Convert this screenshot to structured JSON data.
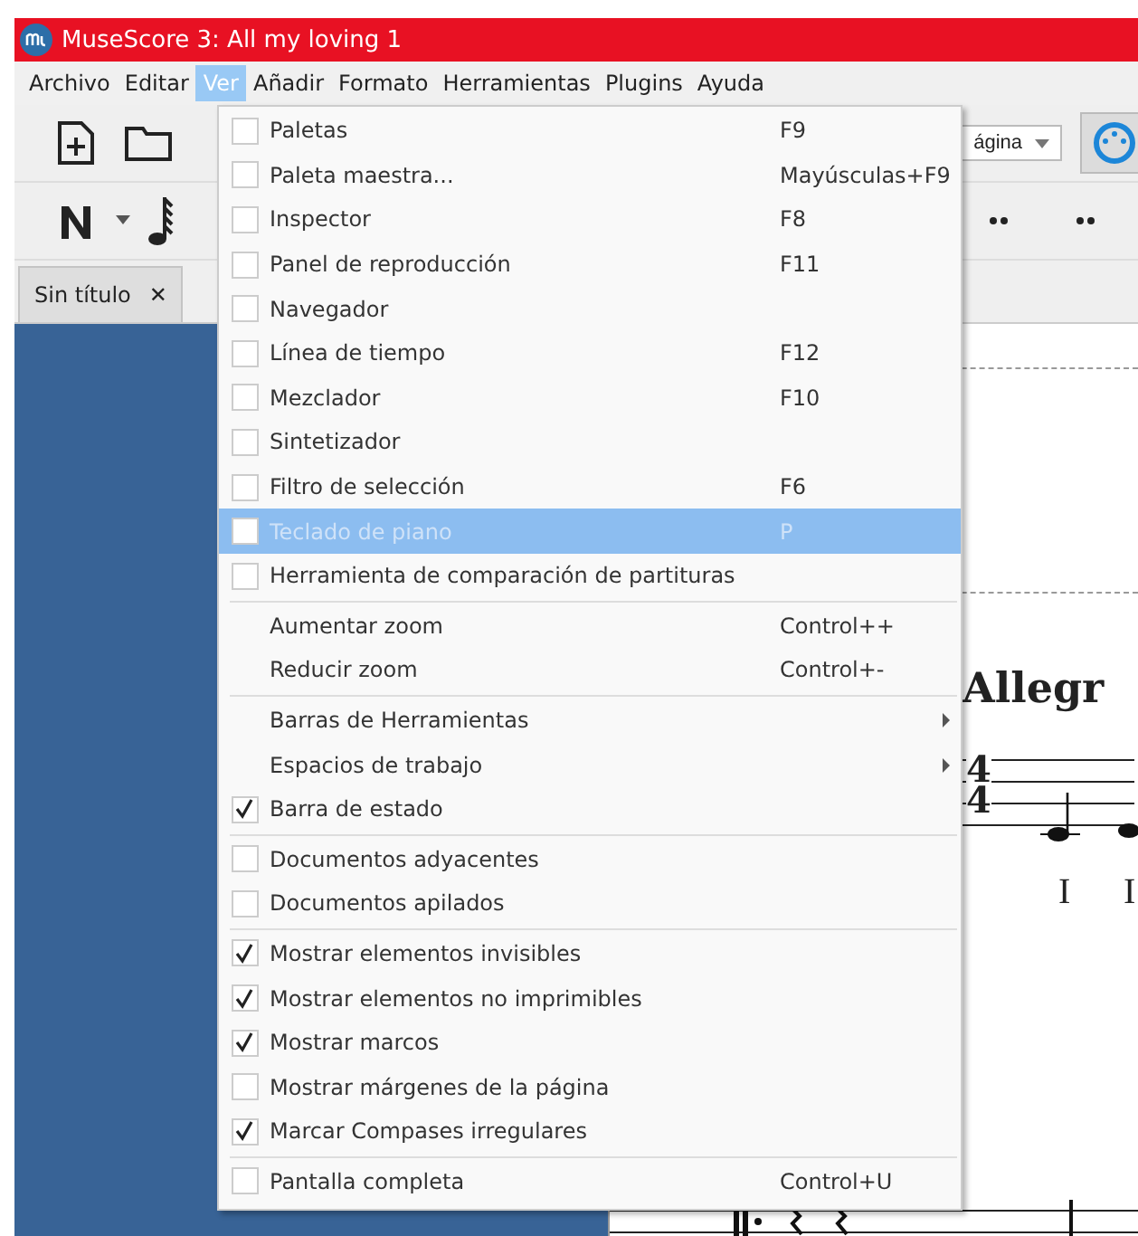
{
  "window": {
    "title": "MuseScore 3: All my loving 1"
  },
  "menu_bar": [
    {
      "label": "Archivo",
      "selected": false
    },
    {
      "label": "Editar",
      "selected": false
    },
    {
      "label": "Ver",
      "selected": true
    },
    {
      "label": "Añadir",
      "selected": false
    },
    {
      "label": "Formato",
      "selected": false
    },
    {
      "label": "Herramientas",
      "selected": false
    },
    {
      "label": "Plugins",
      "selected": false
    },
    {
      "label": "Ayuda",
      "selected": false
    }
  ],
  "toolbar": {
    "view_dropdown": "ágina"
  },
  "tabs": [
    {
      "label": "Sin título",
      "close": "✕"
    }
  ],
  "view_menu": [
    [
      {
        "kind": "check",
        "label": "Paletas",
        "shortcut": "F9",
        "checked": false,
        "selected": false,
        "disabled": false
      },
      {
        "kind": "check",
        "label": "Paleta maestra...",
        "shortcut": "Mayúsculas+F9",
        "checked": false,
        "selected": false,
        "disabled": false
      },
      {
        "kind": "check",
        "label": "Inspector",
        "shortcut": "F8",
        "checked": false,
        "selected": false,
        "disabled": false
      },
      {
        "kind": "check",
        "label": "Panel de reproducción",
        "shortcut": "F11",
        "checked": false,
        "selected": false,
        "disabled": false
      },
      {
        "kind": "check",
        "label": "Navegador",
        "checked": false,
        "selected": false,
        "disabled": false
      },
      {
        "kind": "check",
        "label": "Línea de tiempo",
        "shortcut": "F12",
        "checked": false,
        "selected": false,
        "disabled": false
      },
      {
        "kind": "check",
        "label": "Mezclador",
        "shortcut": "F10",
        "checked": false,
        "selected": false,
        "disabled": false
      },
      {
        "kind": "check",
        "label": "Sintetizador",
        "checked": false,
        "selected": false,
        "disabled": false
      },
      {
        "kind": "check",
        "label": "Filtro de selección",
        "shortcut": "F6",
        "checked": false,
        "selected": false,
        "disabled": false
      },
      {
        "kind": "check",
        "label": "Teclado de piano",
        "shortcut": "P",
        "checked": false,
        "selected": true,
        "disabled": true
      },
      {
        "kind": "check",
        "label": "Herramienta de comparación de partituras",
        "checked": false,
        "selected": false,
        "disabled": false
      }
    ],
    [
      {
        "kind": "plain",
        "label": "Aumentar zoom",
        "shortcut": "Control++",
        "selected": false,
        "disabled": false
      },
      {
        "kind": "plain",
        "label": "Reducir zoom",
        "shortcut": "Control+-",
        "selected": false,
        "disabled": false
      }
    ],
    [
      {
        "kind": "submenu",
        "label": "Barras de Herramientas",
        "selected": false,
        "disabled": false
      },
      {
        "kind": "submenu",
        "label": "Espacios de trabajo",
        "selected": false,
        "disabled": false
      },
      {
        "kind": "check",
        "label": "Barra de estado",
        "checked": true,
        "selected": false,
        "disabled": false
      }
    ],
    [
      {
        "kind": "check",
        "label": "Documentos adyacentes",
        "checked": false,
        "selected": false,
        "disabled": false
      },
      {
        "kind": "check",
        "label": "Documentos apilados",
        "checked": false,
        "selected": false,
        "disabled": false
      }
    ],
    [
      {
        "kind": "check",
        "label": "Mostrar elementos invisibles",
        "checked": true,
        "selected": false,
        "disabled": false
      },
      {
        "kind": "check",
        "label": "Mostrar elementos no imprimibles",
        "checked": true,
        "selected": false,
        "disabled": false
      },
      {
        "kind": "check",
        "label": "Mostrar marcos",
        "checked": true,
        "selected": false,
        "disabled": false
      },
      {
        "kind": "check",
        "label": "Mostrar márgenes de la página",
        "checked": false,
        "selected": false,
        "disabled": false
      },
      {
        "kind": "check",
        "label": "Marcar Compases irregulares",
        "checked": true,
        "selected": false,
        "disabled": false
      }
    ],
    [
      {
        "kind": "check",
        "label": "Pantalla completa",
        "shortcut": "Control+U",
        "checked": false,
        "selected": false,
        "disabled": false
      }
    ]
  ],
  "score": {
    "tempo": "Allegr",
    "time_signature": [
      "4",
      "4"
    ],
    "numerals": [
      "I",
      "I"
    ]
  }
}
